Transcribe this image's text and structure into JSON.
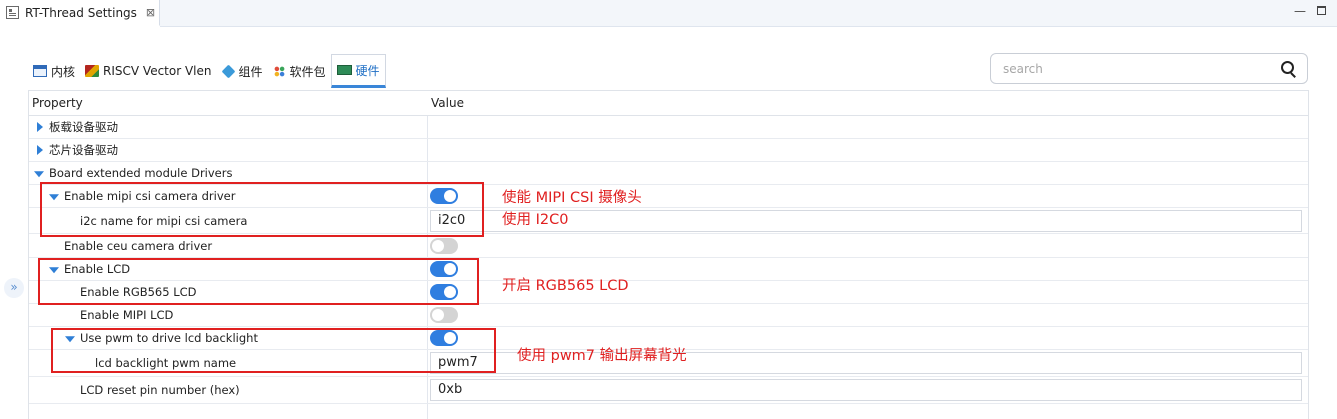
{
  "editor": {
    "title": "RT-Thread Settings",
    "close_glyph": "⊠"
  },
  "window_controls": {
    "minimize": "—"
  },
  "tabs": [
    {
      "label": "内核",
      "icon": "kernel-icon"
    },
    {
      "label": "RISCV Vector Vlen",
      "icon": "riscv-icon"
    },
    {
      "label": "组件",
      "icon": "component-icon"
    },
    {
      "label": "软件包",
      "icon": "package-icon"
    },
    {
      "label": "硬件",
      "icon": "hardware-icon",
      "active": true
    }
  ],
  "search": {
    "placeholder": "search",
    "value": ""
  },
  "collapse_handle": "»",
  "table": {
    "headers": {
      "property": "Property",
      "value": "Value"
    },
    "rows": [
      {
        "label": "板载设备驱动",
        "expander": "collapsed"
      },
      {
        "label": "芯片设备驱动",
        "expander": "collapsed"
      },
      {
        "label": "Board extended module Drivers",
        "expander": "expanded"
      },
      {
        "label": "Enable mipi csi camera driver",
        "expander": "expanded",
        "toggle": true
      },
      {
        "label": "i2c name for mipi csi camera",
        "text": "i2c0"
      },
      {
        "label": "Enable ceu camera driver",
        "toggle": false
      },
      {
        "label": "Enable LCD",
        "expander": "expanded",
        "toggle": true
      },
      {
        "label": "Enable RGB565 LCD",
        "toggle": true
      },
      {
        "label": "Enable MIPI LCD",
        "toggle": false
      },
      {
        "label": "Use pwm to drive lcd backlight",
        "expander": "expanded",
        "toggle": true
      },
      {
        "label": "lcd backlight pwm name",
        "text": "pwm7"
      },
      {
        "label": "LCD reset pin number (hex)",
        "text": "0xb"
      }
    ]
  },
  "annotations": {
    "camera_line1": "使能 MIPI CSI 摄像头",
    "camera_line2": "使用 I2C0",
    "lcd": "开启 RGB565 LCD",
    "pwm": "使用 pwm7 输出屏幕背光",
    "color": "#e02020"
  },
  "colors": {
    "accent": "#2f7ee0",
    "toggle_off": "#d4d4d4"
  }
}
